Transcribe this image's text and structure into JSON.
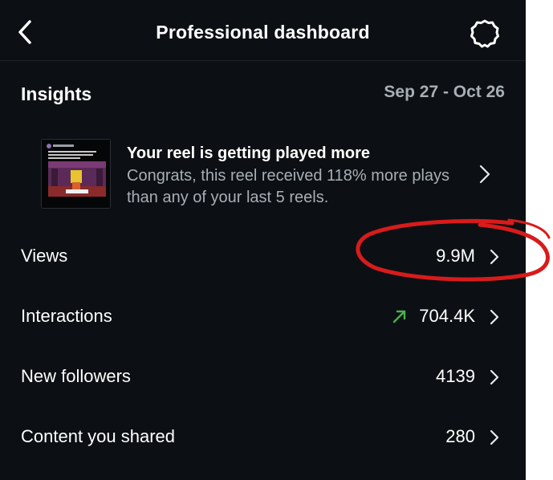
{
  "header": {
    "title": "Professional dashboard",
    "back_icon": "chevron-left-icon",
    "settings_icon": "gear-icon"
  },
  "insights": {
    "title": "Insights",
    "date_range": "Sep 27 - Oct 26"
  },
  "reel_card": {
    "heading": "Your reel is getting played more",
    "body": "Congrats, this reel received 118% more plays than any of your last 5 reels.",
    "thumbnail_icon": "reel-thumbnail"
  },
  "metrics": [
    {
      "label": "Views",
      "value": "9.9M"
    },
    {
      "label": "Interactions",
      "value": "704.4K",
      "trend_icon": "trend-up-arrow-icon",
      "trend_color": "#4caf50"
    },
    {
      "label": "New followers",
      "value": "4139"
    },
    {
      "label": "Content you shared",
      "value": "280"
    }
  ],
  "colors": {
    "background": "#0c1014",
    "text_secondary": "#a8aeb5",
    "annotation_red": "#d81b1b"
  }
}
